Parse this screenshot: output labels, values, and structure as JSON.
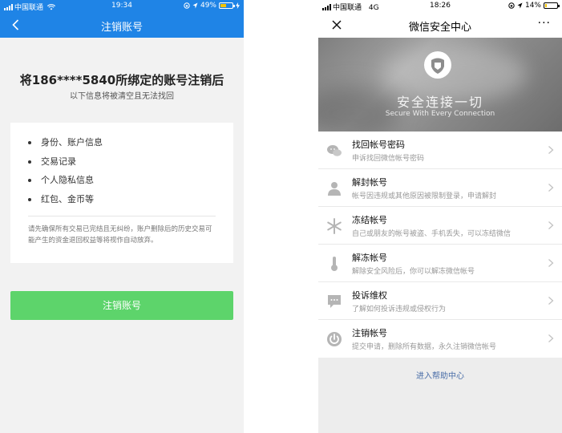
{
  "left_phone": {
    "status": {
      "carrier": "中国联通",
      "time": "19:34",
      "battery_text": "49%",
      "battery_level": 0.49
    },
    "nav": {
      "title": "注销账号"
    },
    "headline": "将186****5840所绑定的账号注销后",
    "subline": "以下信息将被清空且无法找回",
    "list_items": [
      "身份、账户信息",
      "交易记录",
      "个人隐私信息",
      "红包、金币等"
    ],
    "note": "请先确保所有交易已完结且无纠纷，账户删除后的历史交易可能产生的资金退回权益等将视作自动放弃。",
    "button_label": "注销账号",
    "colors": {
      "nav": "#1f84e6",
      "button": "#5dd46b"
    }
  },
  "right_phone": {
    "status": {
      "carrier": "中国联通",
      "network": "4G",
      "time": "18:26",
      "battery_text": "14%",
      "battery_level": 0.14
    },
    "nav": {
      "title": "微信安全中心",
      "more": "···"
    },
    "banner": {
      "slogan": "安全连接一切",
      "slogan_en": "Secure With Every Connection"
    },
    "menu": [
      {
        "title": "找回帐号密码",
        "desc": "申诉找回微信帐号密码",
        "icon": "chat-bubbles-icon"
      },
      {
        "title": "解封帐号",
        "desc": "帐号因违规或其他原因被限制登录，申请解封",
        "icon": "person-icon"
      },
      {
        "title": "冻结帐号",
        "desc": "自己或朋友的帐号被盗、手机丢失，可以冻结微信",
        "icon": "snowflake-icon"
      },
      {
        "title": "解冻帐号",
        "desc": "解除安全风险后，你可以解冻微信帐号",
        "icon": "thermometer-icon"
      },
      {
        "title": "投诉维权",
        "desc": "了解如何投诉违规或侵权行为",
        "icon": "complaint-icon"
      },
      {
        "title": "注销帐号",
        "desc": "提交申请，删除所有数据，永久注销微信帐号",
        "icon": "power-icon"
      }
    ],
    "help_link": "进入帮助中心"
  }
}
